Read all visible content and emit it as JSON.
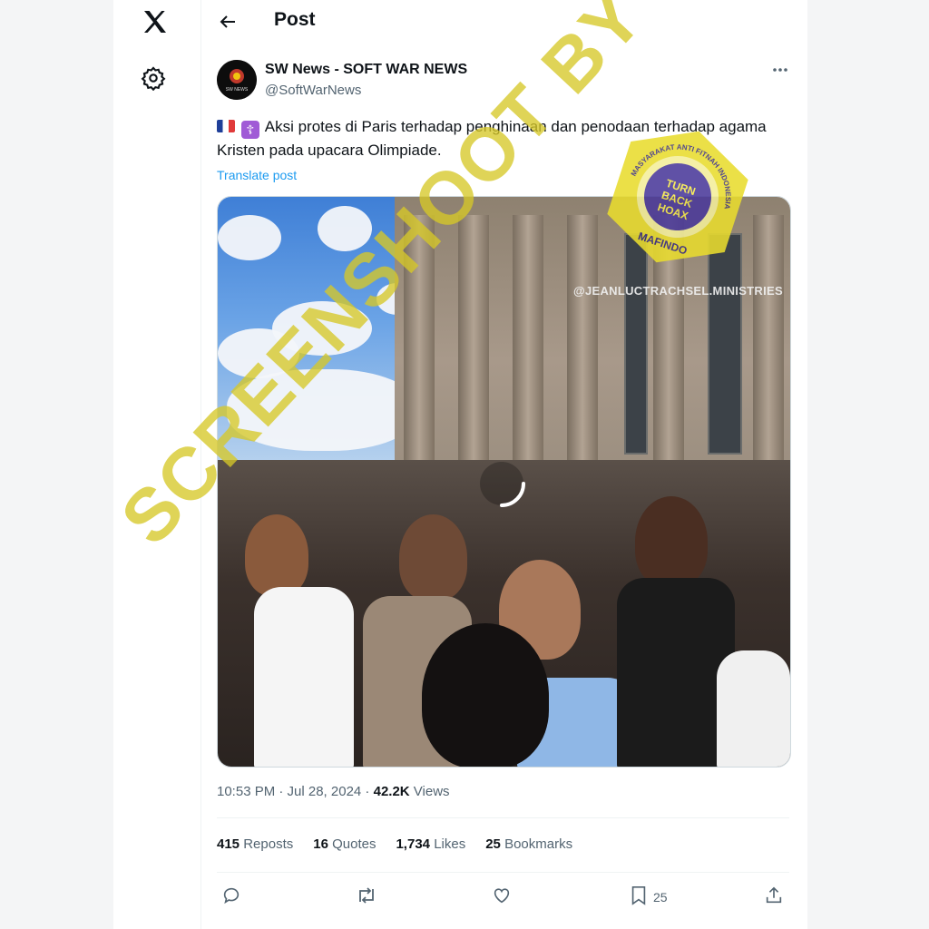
{
  "nav": {
    "logo_icon": "x-logo-icon",
    "settings_icon": "gear-icon"
  },
  "header": {
    "title": "Post"
  },
  "post": {
    "author_name": "SW News - SOFT WAR NEWS",
    "author_handle": "@SoftWarNews",
    "avatar_text": "SW NEWS",
    "text": "Aksi protes di Paris terhadap penghinaan dan penodaan terhadap agama Kristen pada upacara Olimpiade.",
    "translate_label": "Translate post",
    "media": {
      "overlay_handle": "@JEANLUCTRACHSEL.MINISTRIES",
      "loading": true
    },
    "time": "10:53 PM · Jul 28, 2024 · ",
    "views_count": "42.2K",
    "views_label": " Views"
  },
  "stats": {
    "reposts_count": "415",
    "reposts_label": "Reposts",
    "quotes_count": "16",
    "quotes_label": "Quotes",
    "likes_count": "1,734",
    "likes_label": "Likes",
    "bookmarks_count": "25",
    "bookmarks_label": "Bookmarks"
  },
  "actions": {
    "reply_icon": "reply-icon",
    "repost_icon": "repost-icon",
    "like_icon": "heart-icon",
    "bookmark_icon": "bookmark-icon",
    "bookmark_count": "25",
    "share_icon": "share-icon"
  },
  "watermark": {
    "text": "SCREENSHOOT BY",
    "badge_top": "TURN BACK HOAX",
    "badge_arc": "MASYARAKAT ANTI FITNAH INDONESIA",
    "badge_bottom": "MAFINDO"
  },
  "colors": {
    "link": "#1d9bf0",
    "muted": "#536471",
    "watermark": "#d6c828",
    "badge_purple": "#4b3a9a"
  }
}
